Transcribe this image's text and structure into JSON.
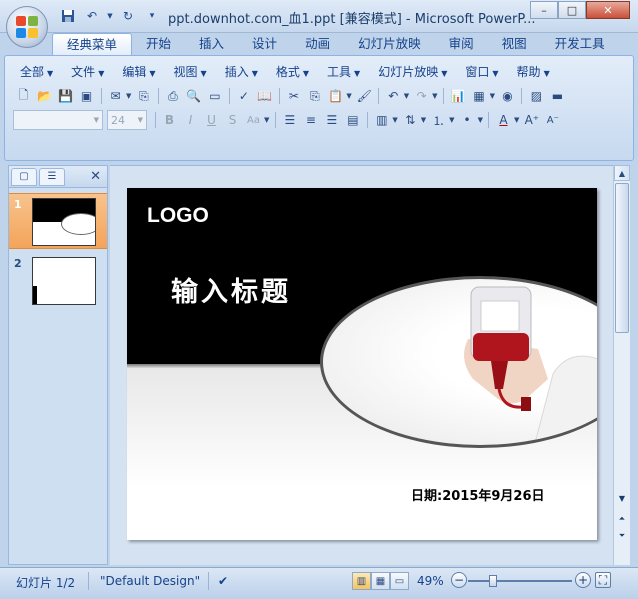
{
  "window": {
    "title": "ppt.downhot.com_血1.ppt [兼容模式] - Microsoft PowerP...",
    "controls": [
      "–",
      "□",
      "✕"
    ]
  },
  "quick_access": [
    "save-icon",
    "undo-icon",
    "redo-icon",
    "customize-icon"
  ],
  "ribbon_tabs": [
    {
      "label": "经典菜单",
      "active": true
    },
    {
      "label": "开始"
    },
    {
      "label": "插入"
    },
    {
      "label": "设计"
    },
    {
      "label": "动画"
    },
    {
      "label": "幻灯片放映"
    },
    {
      "label": "审阅"
    },
    {
      "label": "视图"
    },
    {
      "label": "开发工具"
    }
  ],
  "classic_menu": [
    "全部",
    "文件",
    "编辑",
    "视图",
    "插入",
    "格式",
    "工具",
    "幻灯片放映",
    "窗口",
    "帮助"
  ],
  "format_toolbar": {
    "font_name": "",
    "font_size": "24"
  },
  "left_pane": {
    "tabs": [
      "slides-tab",
      "outline-tab"
    ],
    "thumbnails": [
      {
        "number": "1",
        "selected": true
      },
      {
        "number": "2",
        "selected": false
      }
    ]
  },
  "slide": {
    "logo": "LOGO",
    "title": "输入标题",
    "date": "日期:2015年9月26日"
  },
  "statusbar": {
    "slide_info": "幻灯片 1/2",
    "theme": "\"Default Design\"",
    "zoom": "49%",
    "zoom_fraction": 0.49
  }
}
